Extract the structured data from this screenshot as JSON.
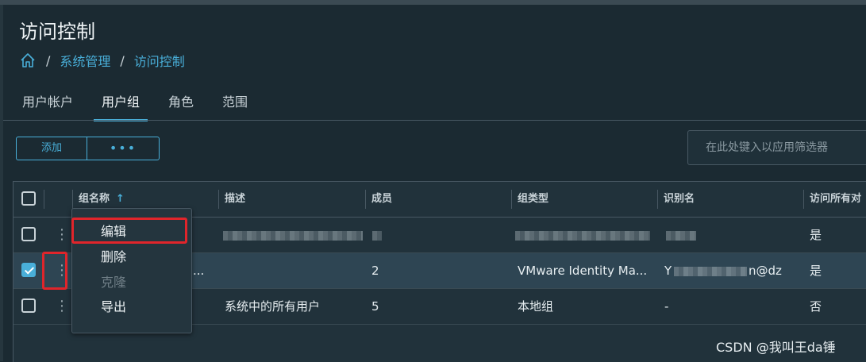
{
  "page": {
    "title": "访问控制"
  },
  "breadcrumb": {
    "items": [
      "系统管理",
      "访问控制"
    ],
    "separator": "/"
  },
  "tabs": [
    {
      "label": "用户帐户",
      "active": false
    },
    {
      "label": "用户组",
      "active": true
    },
    {
      "label": "角色",
      "active": false
    },
    {
      "label": "范围",
      "active": false
    }
  ],
  "toolbar": {
    "add_label": "添加",
    "more_label": "•••"
  },
  "filter": {
    "placeholder": "在此处键入以应用筛选器",
    "value": ""
  },
  "table": {
    "columns": [
      "组名称",
      "描述",
      "成员",
      "组类型",
      "识别名",
      "访问所有对"
    ],
    "sort_arrow": "↑",
    "rows": [
      {
        "name": "",
        "description": "",
        "members": "",
        "type": "",
        "dn": "",
        "access": "是",
        "selected": false
      },
      {
        "name": "...",
        "description": "",
        "members": "2",
        "type": "VMware Identity Ma...",
        "dn": "Y",
        "dn_suffix": "n@dz",
        "access": "是",
        "selected": true
      },
      {
        "name": "",
        "description": "系统中的所有用户",
        "members": "5",
        "type": "本地组",
        "dn": "-",
        "access": "否",
        "selected": false
      }
    ]
  },
  "context_menu": {
    "items": [
      {
        "label": "编辑",
        "disabled": false
      },
      {
        "label": "删除",
        "disabled": false
      },
      {
        "label": "克隆",
        "disabled": true
      },
      {
        "label": "导出",
        "disabled": false
      }
    ]
  },
  "watermark": "CSDN @我叫王da锤",
  "colors": {
    "accent": "#49afd9",
    "highlight": "#e0252b",
    "background": "#1b2a32"
  },
  "icons": {
    "home": "home-icon",
    "row_actions": "kebab-icon"
  }
}
